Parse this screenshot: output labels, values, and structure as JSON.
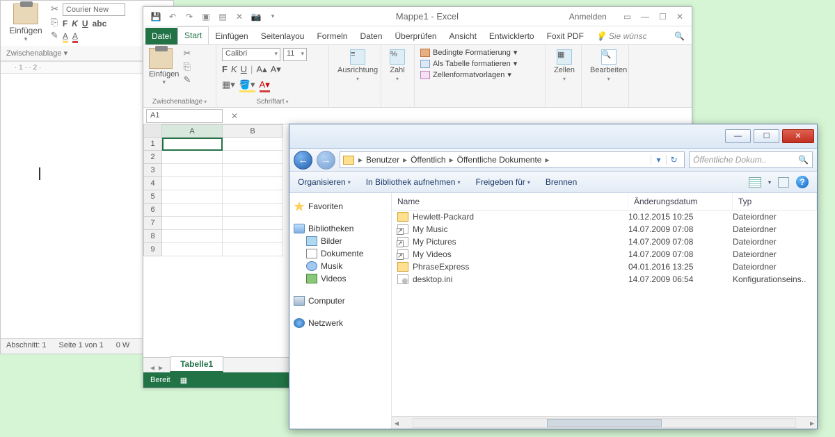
{
  "word": {
    "font_name": "Courier New",
    "paste_label": "Einfügen",
    "clipboard_group": "Zwischenablage",
    "fmt": {
      "bold": "F",
      "italic": "K",
      "underline": "U"
    },
    "status": {
      "section": "Abschnitt: 1",
      "page": "Seite 1 von 1",
      "words": "0 W"
    }
  },
  "excel": {
    "title": "Mappe1 - Excel",
    "signin": "Anmelden",
    "tabs": [
      "Datei",
      "Start",
      "Einfügen",
      "Seitenlayou",
      "Formeln",
      "Daten",
      "Überprüfen",
      "Ansicht",
      "Entwicklerto",
      "Foxit PDF"
    ],
    "tell_me": "Sie wünsc",
    "ribbon": {
      "clipboard": {
        "paste": "Einfügen",
        "group": "Zwischenablage"
      },
      "font": {
        "name": "Calibri",
        "size": "11",
        "group": "Schriftart",
        "bold": "F",
        "italic": "K",
        "underline": "U"
      },
      "align": "Ausrichtung",
      "number": "Zahl",
      "styles": {
        "cond": "Bedingte Formatierung",
        "table": "Als Tabelle formatieren",
        "cell": "Zellenformatvorlagen"
      },
      "cells": "Zellen",
      "editing": "Bearbeiten"
    },
    "namebox": "A1",
    "columns": [
      "A",
      "B"
    ],
    "rows": [
      "1",
      "2",
      "3",
      "4",
      "5",
      "6",
      "7",
      "8",
      "9"
    ],
    "sheet": "Tabelle1",
    "status": "Bereit"
  },
  "explorer": {
    "breadcrumbs": [
      "Benutzer",
      "Öffentlich",
      "Öffentliche Dokumente"
    ],
    "search_placeholder": "Öffentliche Dokum..",
    "toolbar": {
      "organize": "Organisieren",
      "include": "In Bibliothek aufnehmen",
      "share": "Freigeben für",
      "burn": "Brennen"
    },
    "tree": {
      "favorites": "Favoriten",
      "libraries": "Bibliotheken",
      "lib_items": [
        "Bilder",
        "Dokumente",
        "Musik",
        "Videos"
      ],
      "computer": "Computer",
      "network": "Netzwerk"
    },
    "columns": {
      "name": "Name",
      "date": "Änderungsdatum",
      "type": "Typ"
    },
    "files": [
      {
        "icon": "fold",
        "name": "Hewlett-Packard",
        "date": "10.12.2015 10:25",
        "type": "Dateiordner"
      },
      {
        "icon": "short",
        "name": "My Music",
        "date": "14.07.2009 07:08",
        "type": "Dateiordner"
      },
      {
        "icon": "short",
        "name": "My Pictures",
        "date": "14.07.2009 07:08",
        "type": "Dateiordner"
      },
      {
        "icon": "short",
        "name": "My Videos",
        "date": "14.07.2009 07:08",
        "type": "Dateiordner"
      },
      {
        "icon": "fold",
        "name": "PhraseExpress",
        "date": "04.01.2016 13:25",
        "type": "Dateiordner"
      },
      {
        "icon": "ini",
        "name": "desktop.ini",
        "date": "14.07.2009 06:54",
        "type": "Konfigurationseins.."
      }
    ]
  }
}
